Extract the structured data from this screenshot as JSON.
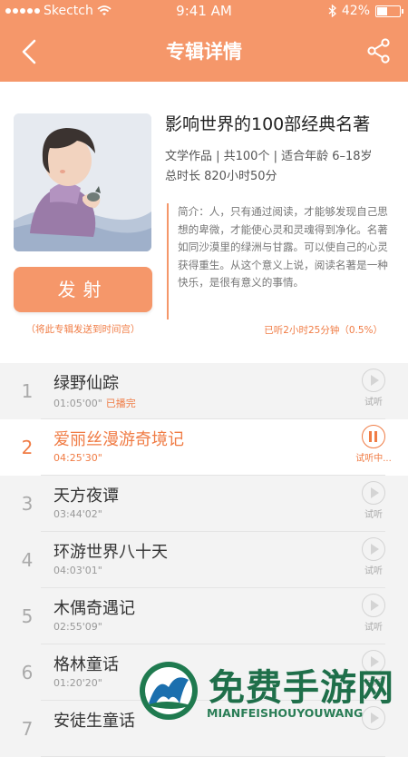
{
  "status_bar": {
    "carrier": "Skectch",
    "time": "9:41 AM",
    "battery": "42%",
    "battery_level": 0.42,
    "icons": [
      "signal-dots-icon",
      "wifi-icon",
      "bluetooth-icon",
      "battery-icon"
    ]
  },
  "nav": {
    "title": "专辑详情",
    "back_icon": "back-arrow-icon",
    "share_icon": "share-icon"
  },
  "album": {
    "title": "影响世界的100部经典名著",
    "meta_line1": "文学作品 | 共100个 | 适合年龄 6–18岁",
    "meta_line2": "总时长 820小时50分",
    "description": "简介：人，只有通过阅读，才能够发现自己思想的卑微，才能使心灵和灵魂得到净化。名著如同沙漠里的绿洲与甘露。可以使自己的心灵获得重生。从这个意义上说，阅读名著是一种快乐，是很有意义的事情。",
    "listened": "已听2小时25分钟（0.5%）",
    "fire_button": "发射",
    "fire_note": "（将此专辑发送到时间宫）"
  },
  "tracks": [
    {
      "num": "1",
      "title": "绿野仙踪",
      "duration": "01:05'00\"",
      "status": "已播完",
      "action": "试听",
      "active": false
    },
    {
      "num": "2",
      "title": "爱丽丝漫游奇境记",
      "duration": "04:25'30\"",
      "status": "",
      "action": "试听中...",
      "active": true
    },
    {
      "num": "3",
      "title": "天方夜谭",
      "duration": "03:44'02\"",
      "status": "",
      "action": "试听",
      "active": false
    },
    {
      "num": "4",
      "title": "环游世界八十天",
      "duration": "04:03'01\"",
      "status": "",
      "action": "试听",
      "active": false
    },
    {
      "num": "5",
      "title": "木偶奇遇记",
      "duration": "02:55'09\"",
      "status": "",
      "action": "试听",
      "active": false
    },
    {
      "num": "6",
      "title": "格林童话",
      "duration": "01:20'20\"",
      "status": "",
      "action": "试听",
      "active": false
    },
    {
      "num": "7",
      "title": "安徒生童话",
      "duration": "",
      "status": "",
      "action": "",
      "active": false
    }
  ],
  "watermark": {
    "title": "免费手游网",
    "subtitle": "MIANFEISHOUYOUWANG"
  },
  "colors": {
    "accent": "#f5976a",
    "accent_text": "#f07c45",
    "list_bg": "#f3f3f3"
  }
}
